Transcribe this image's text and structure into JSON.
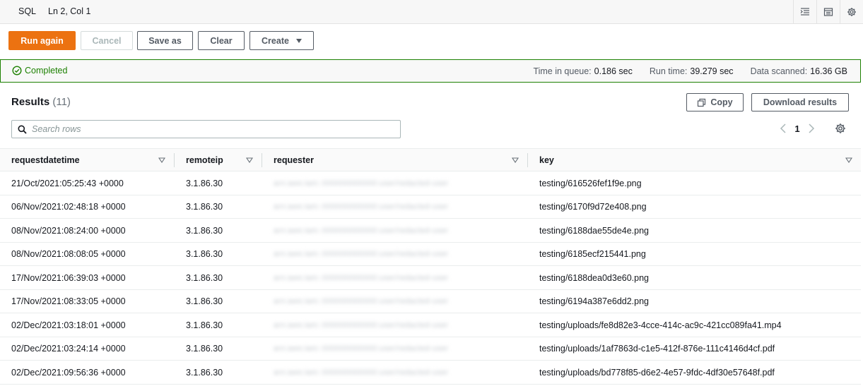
{
  "statusbar": {
    "language": "SQL",
    "cursor": "Ln 2, Col 1",
    "tools": [
      "format-icon",
      "table-icon",
      "settings-icon"
    ]
  },
  "toolbar": {
    "run_again": "Run again",
    "cancel": "Cancel",
    "save_as": "Save as",
    "clear": "Clear",
    "create": "Create"
  },
  "banner": {
    "status": "Completed",
    "time_in_queue_label": "Time in queue:",
    "time_in_queue": "0.186 sec",
    "run_time_label": "Run time:",
    "run_time": "39.279 sec",
    "data_scanned_label": "Data scanned:",
    "data_scanned": "16.36 GB"
  },
  "results": {
    "title": "Results",
    "count": "(11)",
    "copy": "Copy",
    "download": "Download results",
    "search_placeholder": "Search rows",
    "page": "1"
  },
  "table": {
    "columns": [
      "requestdatetime",
      "remoteip",
      "requester",
      "key"
    ],
    "rows": [
      {
        "requestdatetime": "21/Oct/2021:05:25:43 +0000",
        "remoteip": "3.1.86.30",
        "requester": "arn:aws:iam::000000000000:user/redacted-user",
        "key": "testing/616526fef1f9e.png"
      },
      {
        "requestdatetime": "06/Nov/2021:02:48:18 +0000",
        "remoteip": "3.1.86.30",
        "requester": "arn:aws:iam::000000000000:user/redacted-user",
        "key": "testing/6170f9d72e408.png"
      },
      {
        "requestdatetime": "08/Nov/2021:08:24:00 +0000",
        "remoteip": "3.1.86.30",
        "requester": "arn:aws:iam::000000000000:user/redacted-user",
        "key": "testing/6188dae55de4e.png"
      },
      {
        "requestdatetime": "08/Nov/2021:08:08:05 +0000",
        "remoteip": "3.1.86.30",
        "requester": "arn:aws:iam::000000000000:user/redacted-user",
        "key": "testing/6185ecf215441.png"
      },
      {
        "requestdatetime": "17/Nov/2021:06:39:03 +0000",
        "remoteip": "3.1.86.30",
        "requester": "arn:aws:iam::000000000000:user/redacted-user",
        "key": "testing/6188dea0d3e60.png"
      },
      {
        "requestdatetime": "17/Nov/2021:08:33:05 +0000",
        "remoteip": "3.1.86.30",
        "requester": "arn:aws:iam::000000000000:user/redacted-user",
        "key": "testing/6194a387e6dd2.png"
      },
      {
        "requestdatetime": "02/Dec/2021:03:18:01 +0000",
        "remoteip": "3.1.86.30",
        "requester": "arn:aws:iam::000000000000:user/redacted-user",
        "key": "testing/uploads/fe8d82e3-4cce-414c-ac9c-421cc089fa41.mp4"
      },
      {
        "requestdatetime": "02/Dec/2021:03:24:14 +0000",
        "remoteip": "3.1.86.30",
        "requester": "arn:aws:iam::000000000000:user/redacted-user",
        "key": "testing/uploads/1af7863d-c1e5-412f-876e-111c4146d4cf.pdf"
      },
      {
        "requestdatetime": "02/Dec/2021:09:56:36 +0000",
        "remoteip": "3.1.86.30",
        "requester": "arn:aws:iam::000000000000:user/redacted-user",
        "key": "testing/uploads/bd778f85-d6e2-4e57-9fdc-4df30e57648f.pdf"
      }
    ]
  },
  "colors": {
    "primary": "#ec7211",
    "success": "#1d8102",
    "text": "#16191f",
    "muted": "#545b64"
  }
}
